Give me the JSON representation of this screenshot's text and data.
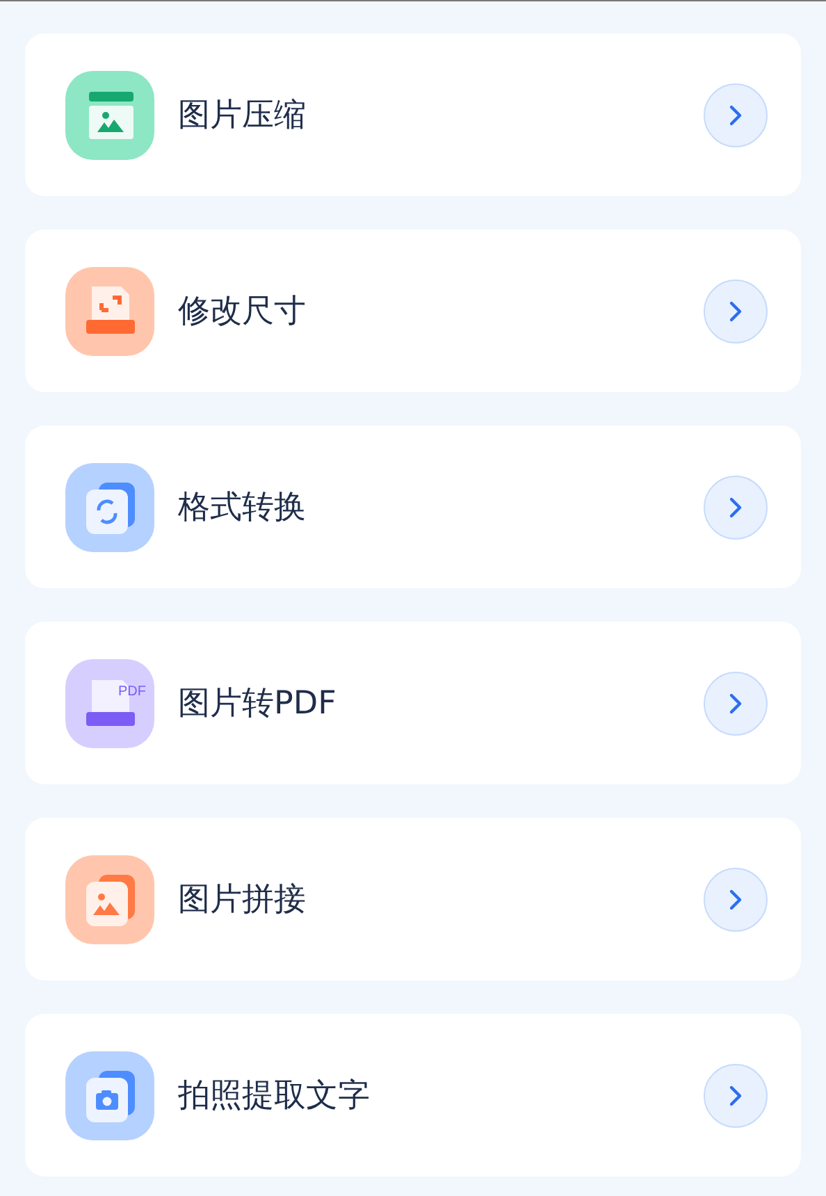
{
  "items": [
    {
      "label": "图片压缩",
      "kind": "compress"
    },
    {
      "label": "修改尺寸",
      "kind": "resize"
    },
    {
      "label": "格式转换",
      "kind": "convert"
    },
    {
      "label": "图片转PDF",
      "kind": "pdf",
      "icon_text": "PDF"
    },
    {
      "label": "图片拼接",
      "kind": "stitch"
    },
    {
      "label": "拍照提取文字",
      "kind": "camera"
    }
  ]
}
